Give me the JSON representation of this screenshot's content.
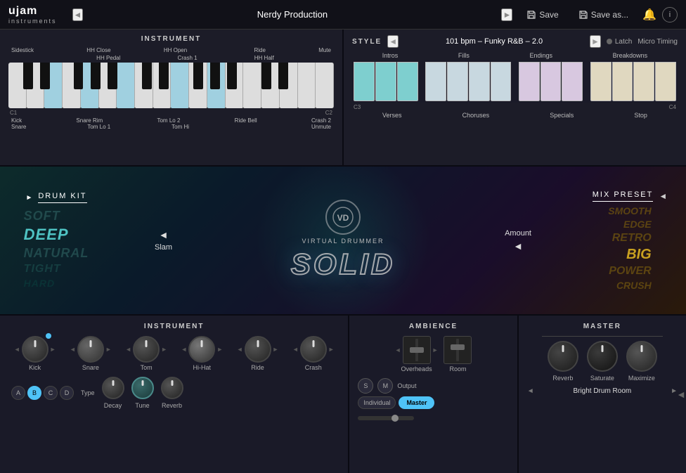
{
  "topbar": {
    "logo": "ujam",
    "instruments": "instruments",
    "preset_name": "Nerdy Production",
    "save_label": "Save",
    "save_as_label": "Save as...",
    "nav_prev": "◄",
    "nav_next": "►"
  },
  "instrument_panel": {
    "title": "INSTRUMENT",
    "labels_top": [
      "HH Close",
      "HH Open",
      "Ride",
      "Mute"
    ],
    "labels_mid": [
      "HH Pedal",
      "Crash 1",
      "HH Half"
    ],
    "labels_left": [
      "Sidestick"
    ],
    "keys_c1": "C1",
    "keys_c2": "C2",
    "labels_bottom_left": [
      "Kick",
      "Snare Rim",
      "Tom Lo 2",
      "",
      "Ride Bell",
      "Crash 2"
    ],
    "labels_bottom_right": [
      "Snare",
      "Tom Lo 1",
      "Tom Hi",
      "",
      "",
      "Unmute"
    ]
  },
  "style_panel": {
    "title": "STYLE",
    "bpm": "101 bpm – Funky R&B – 2.0",
    "latch": "Latch",
    "micro_timing": "Micro Timing",
    "sections_top": [
      "Intros",
      "Fills",
      "Endings",
      "Breakdowns"
    ],
    "keys_c3": "C3",
    "keys_c4": "C4",
    "sections_bottom": [
      "Verses",
      "Choruses",
      "Specials",
      "Stop"
    ]
  },
  "middle": {
    "drum_kit_label": "DRUM KIT",
    "kit_arrow": "►",
    "kit_options": [
      "SOFT",
      "DEEP",
      "NATURAL",
      "TIGHT",
      "HARD"
    ],
    "kit_selected_index": 1,
    "vd_label": "VIRTUAL DRUMMER",
    "solid_label": "SOLID",
    "slam_label": "Slam",
    "amount_label": "Amount",
    "mix_preset_label": "MIX PRESET",
    "mix_arrow": "◄",
    "mix_options": [
      "SMOOTH",
      "EDGE",
      "RETRO",
      "BIG",
      "POWER",
      "CRUSH"
    ]
  },
  "bottom": {
    "instrument_title": "INSTRUMENT",
    "ambience_title": "AMBIENCE",
    "master_title": "MASTER",
    "channels": [
      "Kick",
      "Snare",
      "Tom",
      "Hi-Hat",
      "Ride",
      "Crash"
    ],
    "ambience_channels": [
      "Overheads",
      "Room"
    ],
    "master_knobs": [
      "Reverb",
      "Saturate",
      "Maximize"
    ],
    "abcd_buttons": [
      "A",
      "B",
      "C",
      "D"
    ],
    "abcd_active": "B",
    "bottom_knobs": [
      "Decay",
      "Tune",
      "Reverb"
    ],
    "type_label": "Type",
    "output_label": "Output",
    "individual_label": "Individual",
    "master_label": "Master",
    "s_label": "S",
    "m_label": "M",
    "reverb_preset": "Bright Drum Room"
  }
}
